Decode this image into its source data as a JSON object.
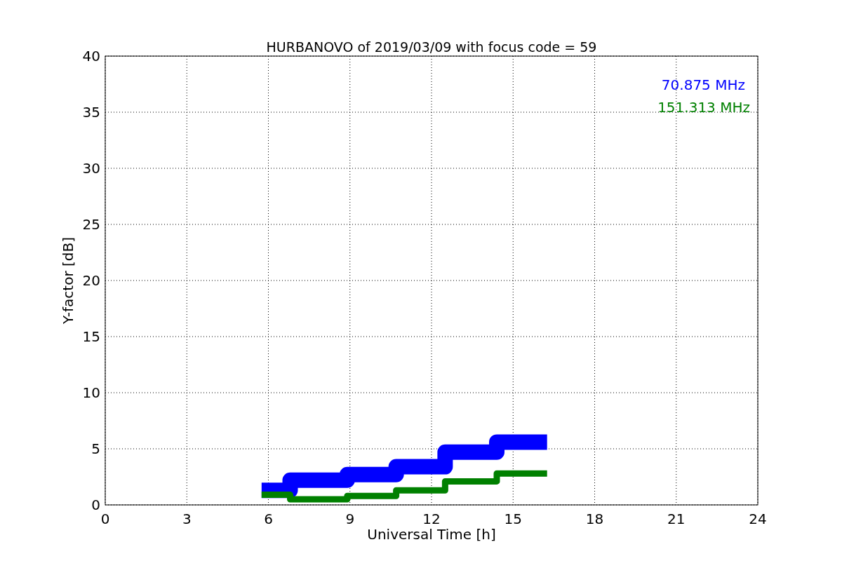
{
  "figure": {
    "chart_data": {
      "type": "line",
      "title": "HURBANOVO of 2019/03/09 with focus code = 59",
      "xlabel": "Universal Time [h]",
      "ylabel": "Y-factor [dB]",
      "x": [
        5.75,
        6.8,
        6.8,
        8.9,
        8.9,
        10.7,
        10.7,
        12.5,
        12.5,
        14.4,
        14.4,
        16.25
      ],
      "series": [
        {
          "name": "70.875 MHz",
          "color": "#0000ff",
          "values": [
            1.3,
            1.3,
            2.2,
            2.2,
            2.7,
            2.7,
            3.4,
            3.4,
            4.7,
            4.7,
            5.6,
            5.6
          ]
        },
        {
          "name": "151.313 MHz",
          "color": "#008000",
          "values": [
            0.9,
            0.9,
            0.5,
            0.5,
            0.8,
            0.8,
            1.3,
            1.3,
            2.1,
            2.1,
            2.8,
            2.8
          ]
        }
      ],
      "xlim": [
        0,
        24
      ],
      "ylim": [
        0,
        40
      ],
      "xticks": [
        0,
        3,
        6,
        9,
        12,
        15,
        18,
        21,
        24
      ],
      "yticks": [
        0,
        5,
        10,
        15,
        20,
        25,
        30,
        35,
        40
      ],
      "grid": true
    }
  }
}
